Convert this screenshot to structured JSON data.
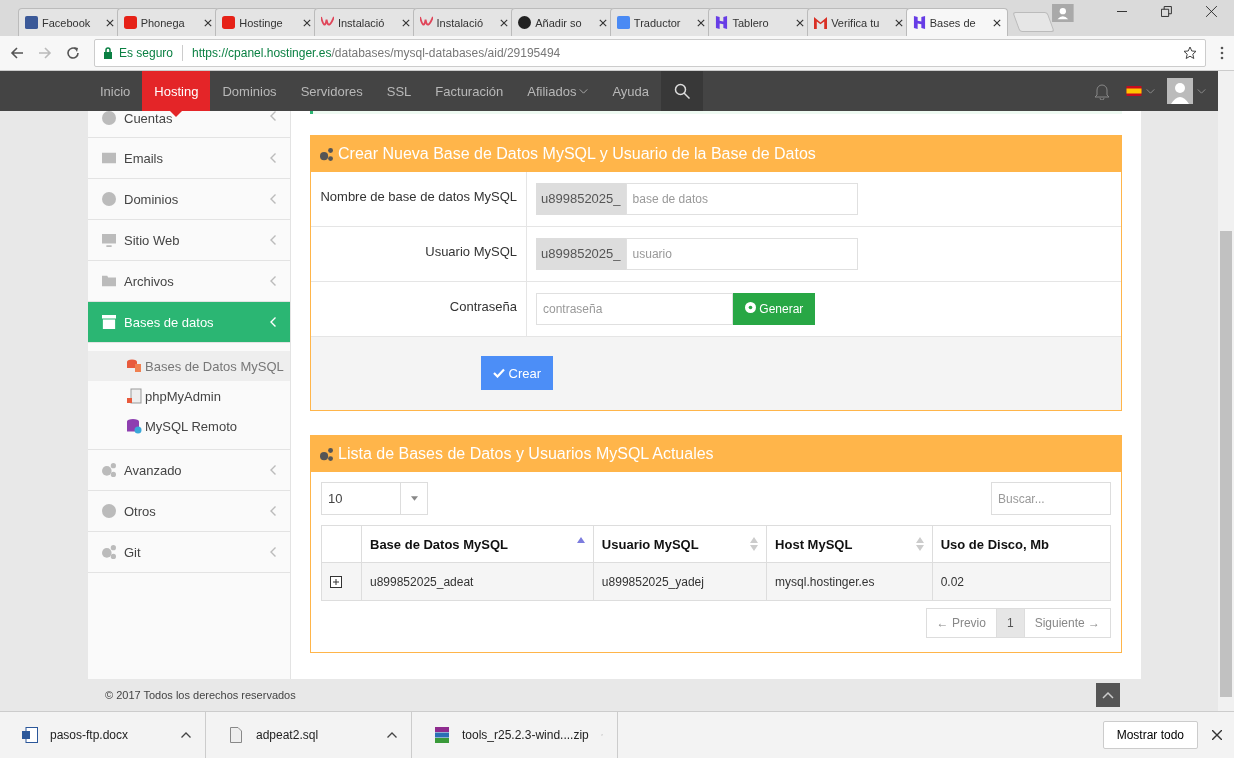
{
  "browser": {
    "tabs": [
      {
        "label": "Facebook",
        "kind": "facebook",
        "selected": false
      },
      {
        "label": "Phonega",
        "kind": "youtube",
        "selected": false
      },
      {
        "label": "Hostinge",
        "kind": "youtube",
        "selected": false
      },
      {
        "label": "Instalació",
        "kind": "ow",
        "selected": false
      },
      {
        "label": "Instalació",
        "kind": "ow",
        "selected": false
      },
      {
        "label": "Añadir so",
        "kind": "github",
        "selected": false
      },
      {
        "label": "Traductor",
        "kind": "translate",
        "selected": false
      },
      {
        "label": "Tablero",
        "kind": "hostinger",
        "selected": false
      },
      {
        "label": "Verifica tu",
        "kind": "gmail",
        "selected": false
      },
      {
        "label": "Bases de",
        "kind": "hostinger",
        "selected": true
      }
    ],
    "secure_label": "Es seguro",
    "url_host": "https://cpanel.hostinger.es",
    "url_path": "/databases/mysql-databases/aid/29195494"
  },
  "nav": {
    "items": [
      {
        "label": "Inicio",
        "selected": false,
        "dropdown": false
      },
      {
        "label": "Hosting",
        "selected": true,
        "dropdown": false
      },
      {
        "label": "Dominios",
        "selected": false,
        "dropdown": false
      },
      {
        "label": "Servidores",
        "selected": false,
        "dropdown": false
      },
      {
        "label": "SSL",
        "selected": false,
        "dropdown": false
      },
      {
        "label": "Facturación",
        "selected": false,
        "dropdown": false
      },
      {
        "label": "Afiliados",
        "selected": false,
        "dropdown": true
      },
      {
        "label": "Ayuda",
        "selected": false,
        "dropdown": false
      }
    ]
  },
  "sidebar": {
    "items": [
      {
        "label": "Cuentas",
        "kind": "info",
        "selected": false
      },
      {
        "label": "Emails",
        "kind": "mail",
        "selected": false
      },
      {
        "label": "Dominios",
        "kind": "globe",
        "selected": false
      },
      {
        "label": "Sitio Web",
        "kind": "monitor",
        "selected": false
      },
      {
        "label": "Archivos",
        "kind": "folder",
        "selected": false
      },
      {
        "label": "Bases de datos",
        "kind": "archive",
        "selected": true,
        "children": [
          {
            "label": "Bases de Datos MySQL",
            "kind": "dbs",
            "selected": true
          },
          {
            "label": "phpMyAdmin",
            "kind": "doc",
            "selected": false
          },
          {
            "label": "MySQL Remoto",
            "kind": "dbglobe",
            "selected": false
          }
        ]
      },
      {
        "label": "Avanzado",
        "kind": "gears",
        "selected": false
      },
      {
        "label": "Otros",
        "kind": "gear",
        "selected": false
      },
      {
        "label": "Git",
        "kind": "gears",
        "selected": false
      }
    ]
  },
  "create_panel": {
    "title": "Crear Nueva Base de Datos MySQL y Usuario de la Base de Datos",
    "rows": [
      {
        "label": "Nombre de base de datos MySQL",
        "prefix": "u899852025_",
        "placeholder": "base de datos"
      },
      {
        "label": "Usuario MySQL",
        "prefix": "u899852025_",
        "placeholder": "usuario"
      },
      {
        "label": "Contraseña",
        "placeholder": "contraseña",
        "button": "Generar"
      }
    ],
    "submit": "Crear"
  },
  "list_panel": {
    "title": "Lista de Bases de Datos y Usuarios MySQL Actuales",
    "page_size": "10",
    "search_placeholder": "Buscar...",
    "columns": [
      {
        "label": "Base de Datos MySQL",
        "kind": "asc"
      },
      {
        "label": "Usuario MySQL",
        "kind": "both"
      },
      {
        "label": "Host MySQL",
        "kind": "both"
      },
      {
        "label": "Uso de Disco, Mb",
        "kind": "none"
      }
    ],
    "rows": [
      [
        "u899852025_adeat",
        "u899852025_yadej",
        "mysql.hostinger.es",
        "0.02"
      ]
    ],
    "pagination": [
      {
        "label": "← Previo",
        "selected": false
      },
      {
        "label": "1",
        "selected": true
      },
      {
        "label": "Siguiente →",
        "selected": false
      }
    ]
  },
  "footer": "© 2017 Todos los derechos reservados",
  "downloads": {
    "items": [
      {
        "name": "pasos-ftp.docx",
        "kind": "word"
      },
      {
        "name": "adpeat2.sql",
        "kind": "file"
      },
      {
        "name": "tools_r25.2.3-wind....zip",
        "kind": "archive"
      }
    ],
    "show_all": "Mostrar todo"
  }
}
